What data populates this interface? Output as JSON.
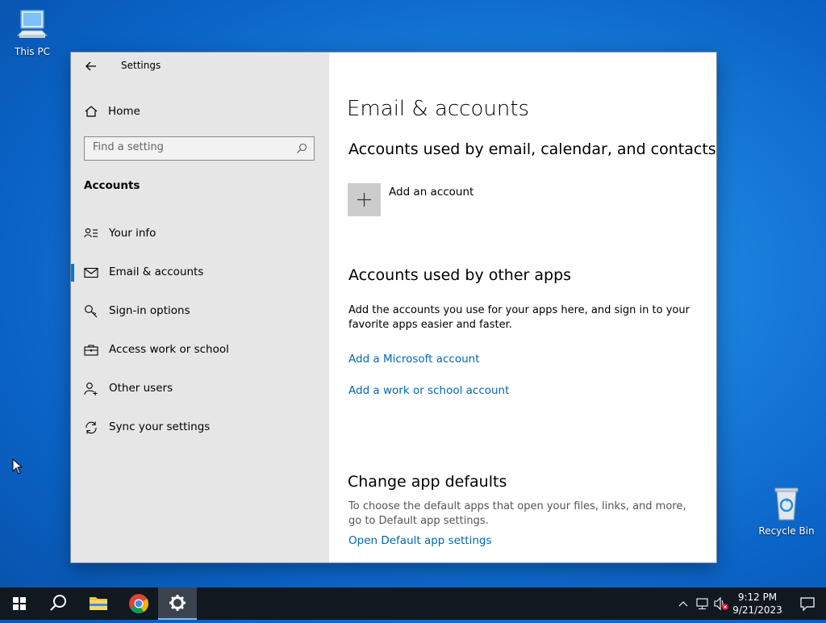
{
  "desktop": {
    "icons": [
      {
        "label": "This PC",
        "icon": "computer-icon"
      },
      {
        "label": "Recycle Bin",
        "icon": "recycle-bin-icon"
      }
    ]
  },
  "window": {
    "app_title": "Settings",
    "sidebar": {
      "home_label": "Home",
      "search_placeholder": "Find a setting",
      "section_heading": "Accounts",
      "items": [
        {
          "label": "Your info",
          "icon": "user-info-icon",
          "active": false
        },
        {
          "label": "Email & accounts",
          "icon": "mail-icon",
          "active": true
        },
        {
          "label": "Sign-in options",
          "icon": "key-icon",
          "active": false
        },
        {
          "label": "Access work or school",
          "icon": "briefcase-icon",
          "active": false
        },
        {
          "label": "Other users",
          "icon": "add-user-icon",
          "active": false
        },
        {
          "label": "Sync your settings",
          "icon": "sync-icon",
          "active": false
        }
      ]
    },
    "content": {
      "page_title": "Email & accounts",
      "section1_heading": "Accounts used by email, calendar, and contacts",
      "add_account_label": "Add an account",
      "section2_heading": "Accounts used by other apps",
      "section2_description": "Add the accounts you use for your apps here, and sign in to your favorite apps easier and faster.",
      "add_microsoft_account_link": "Add a Microsoft account",
      "add_work_school_link": "Add a work or school account",
      "section3_heading": "Change app defaults",
      "section3_description": "To choose the default apps that open your files, links, and more, go to Default app settings.",
      "open_default_apps_link": "Open Default app settings"
    }
  },
  "taskbar": {
    "apps": [
      "start-icon",
      "search-icon",
      "file-explorer-icon",
      "chrome-icon",
      "settings-icon"
    ],
    "clock": {
      "time": "9:12 PM",
      "date": "9/21/2023"
    }
  },
  "colors": {
    "accent": "#0078d7",
    "link": "#0067b8",
    "sidebar_bg": "#e6e6e6",
    "taskbar_bg": "#101820"
  }
}
